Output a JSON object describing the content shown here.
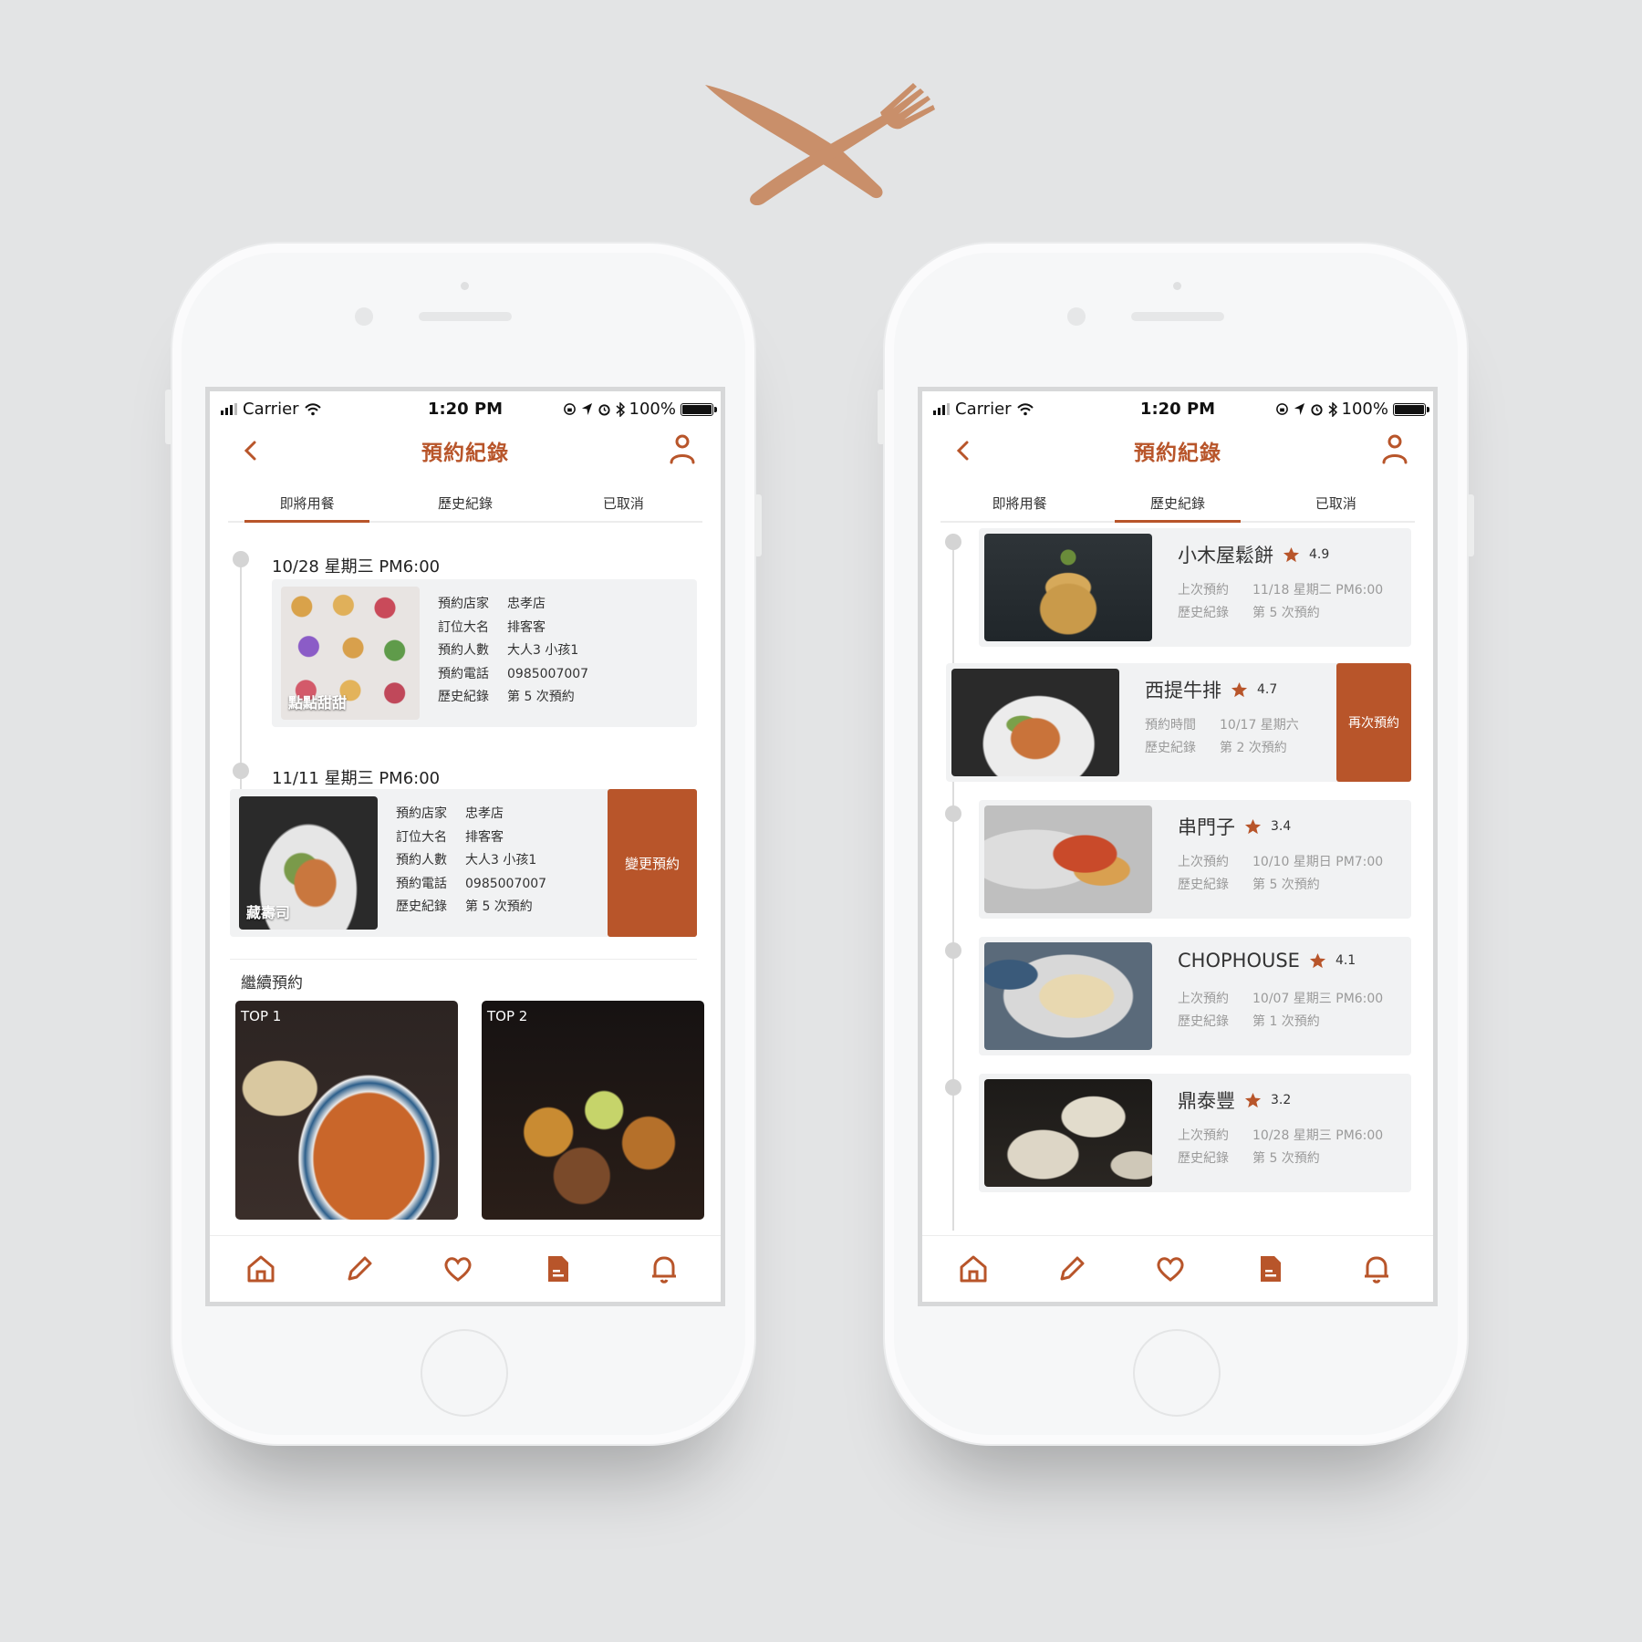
{
  "brand": {
    "accent": "#b8552a",
    "logo_icon": "knife-fork-icon"
  },
  "status_bar": {
    "carrier": "Carrier",
    "time": "1:20 PM",
    "battery": "100%"
  },
  "left_screen": {
    "title": "預約紀錄",
    "tabs": [
      "即將用餐",
      "歷史紀錄",
      "已取消"
    ],
    "active_tab": 0,
    "upcoming": [
      {
        "date": "10/28 星期三 PM6:00",
        "image_label": "點點甜甜",
        "rows": [
          {
            "k": "預約店家",
            "v": "忠孝店"
          },
          {
            "k": "訂位大名",
            "v": "排客客"
          },
          {
            "k": "預約人數",
            "v": "大人3 小孩1"
          },
          {
            "k": "預約電話",
            "v": "0985007007"
          },
          {
            "k": "歷史紀錄",
            "v": "第 5 次預約"
          }
        ]
      },
      {
        "date": "11/11 星期三 PM6:00",
        "image_label": "藏壽司",
        "action": "變更預約",
        "rows": [
          {
            "k": "預約店家",
            "v": "忠孝店"
          },
          {
            "k": "訂位大名",
            "v": "排客客"
          },
          {
            "k": "預約人數",
            "v": "大人3 小孩1"
          },
          {
            "k": "預約電話",
            "v": "0985007007"
          },
          {
            "k": "歷史紀錄",
            "v": "第 5 次預約"
          }
        ]
      }
    ],
    "continue_title": "繼續預約",
    "top": [
      {
        "label": "TOP 1"
      },
      {
        "label": "TOP 2"
      }
    ]
  },
  "right_screen": {
    "title": "預約紀錄",
    "tabs": [
      "即將用餐",
      "歷史紀錄",
      "已取消"
    ],
    "active_tab": 1,
    "history": [
      {
        "name": "小木屋鬆餅",
        "score": "4.9",
        "k1": "上次預約",
        "v1": "11/18 星期二 PM6:00",
        "k2": "歷史紀錄",
        "v2": "第 5 次預約"
      },
      {
        "name": "西提牛排",
        "score": "4.7",
        "k1": "預約時間",
        "v1": "10/17 星期六",
        "k2": "歷史紀錄",
        "v2": "第 2 次預約",
        "action": "再次預約"
      },
      {
        "name": "串門子",
        "score": "3.4",
        "k1": "上次預約",
        "v1": "10/10 星期日 PM7:00",
        "k2": "歷史紀錄",
        "v2": "第 5 次預約"
      },
      {
        "name": "CHOPHOUSE",
        "score": "4.1",
        "k1": "上次預約",
        "v1": "10/07 星期三 PM6:00",
        "k2": "歷史紀錄",
        "v2": "第 1 次預約"
      },
      {
        "name": "鼎泰豐",
        "score": "3.2",
        "k1": "上次預約",
        "v1": "10/28 星期三 PM6:00",
        "k2": "歷史紀錄",
        "v2": "第 5 次預約"
      }
    ]
  },
  "tab_bar": [
    "home-icon",
    "pencil-icon",
    "heart-icon",
    "document-icon",
    "bell-icon"
  ]
}
